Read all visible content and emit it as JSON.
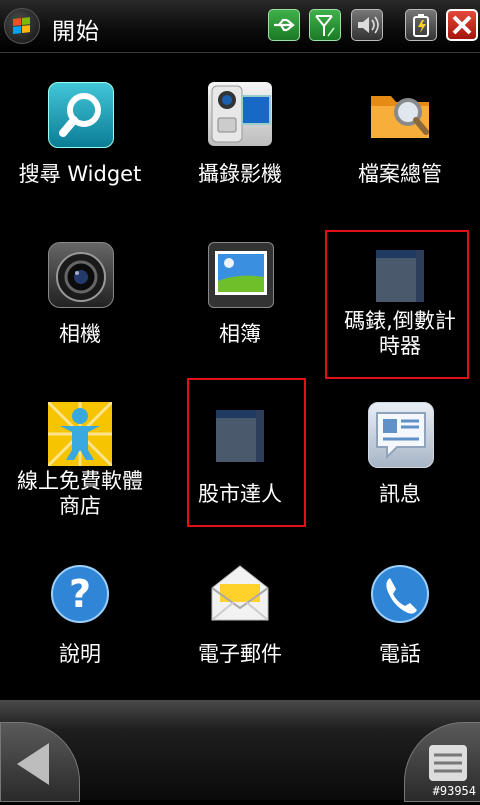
{
  "statusbar": {
    "title": "開始",
    "icons": [
      "windows-start-icon",
      "usb-icon",
      "signal-icon",
      "volume-icon",
      "battery-charging-icon",
      "close-icon"
    ]
  },
  "grid": [
    {
      "label": "搜尋 Widget",
      "icon": "search-icon"
    },
    {
      "label": "攝錄影機",
      "icon": "camcorder-icon"
    },
    {
      "label": "檔案總管",
      "icon": "file-explorer-icon"
    },
    {
      "label": "相機",
      "icon": "camera-icon"
    },
    {
      "label": "相簿",
      "icon": "photo-album-icon"
    },
    {
      "label": "碼錶,倒數計時器",
      "line1": "碼錶,倒數計",
      "line2": "時器",
      "icon": "stopwatch-app-icon",
      "highlighted": true
    },
    {
      "label": "線上免費軟體商店",
      "line1": "線上免費軟體",
      "line2": "商店",
      "icon": "marketplace-icon"
    },
    {
      "label": "股市達人",
      "icon": "stock-app-icon",
      "highlighted": true
    },
    {
      "label": "訊息",
      "icon": "messaging-icon"
    },
    {
      "label": "說明",
      "icon": "help-icon"
    },
    {
      "label": "電子郵件",
      "icon": "email-icon"
    },
    {
      "label": "電話",
      "icon": "phone-icon"
    }
  ],
  "bottombar": {
    "back": "back-arrow-icon",
    "menu": "menu-icon"
  },
  "watermark": "#93954",
  "colors": {
    "highlight": "#e3101a",
    "background": "#000000",
    "text": "#ffffff"
  }
}
